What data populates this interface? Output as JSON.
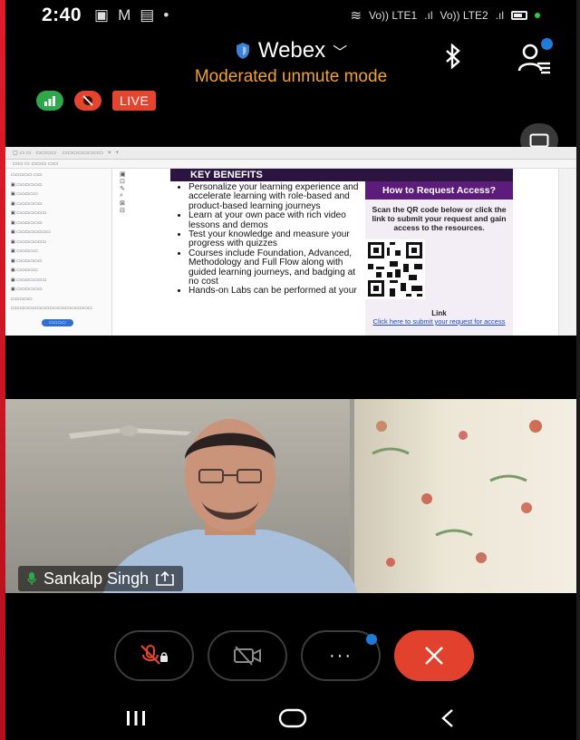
{
  "status_bar": {
    "time": "2:40",
    "signal_1": "Vo)) LTE1",
    "signal_2": "Vo)) LTE2",
    "notif_icons": [
      "image-icon",
      "gmail-icon",
      "gallery-icon",
      "dot-icon"
    ]
  },
  "header": {
    "title": "Webex",
    "subtitle": "Moderated unmute mode"
  },
  "badges": {
    "live_label": "LIVE"
  },
  "shared_screen": {
    "key_benefits_title": "KEY BENEFITS",
    "benefits": [
      "Personalize your learning experience and accelerate learning with role-based and product-based learning journeys",
      "Learn at your own pace with rich video lessons and demos",
      "Test your knowledge and measure your progress with quizzes",
      "Courses include Foundation, Advanced, Methodology and Full Flow along with guided learning journeys, and badging at no cost",
      "Hands-on Labs can be performed at your"
    ],
    "request_title": "How to Request Access?",
    "request_text": "Scan the QR code below or click the link to submit your request and gain access to the resources.",
    "link_label": "Link",
    "link_text": "Click here to submit your request for access"
  },
  "video": {
    "participant_name": "Sankalp Singh"
  },
  "colors": {
    "accent_orange": "#f0a135",
    "end_call_red": "#e2412e",
    "live_red": "#e4452e",
    "badge_blue": "#1e7cd8"
  }
}
